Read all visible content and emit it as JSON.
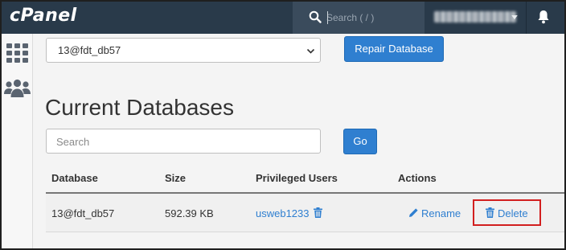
{
  "topbar": {
    "logo": "cPanel",
    "search_placeholder": "Search ( / )",
    "bell_icon": "bell-icon"
  },
  "sidebar": {
    "items": [
      {
        "icon": "grid-icon"
      },
      {
        "icon": "users-icon"
      }
    ]
  },
  "repair": {
    "selected_db": "13@fdt_db57",
    "button_label": "Repair Database"
  },
  "current": {
    "heading": "Current Databases",
    "search_placeholder": "Search",
    "go_label": "Go",
    "columns": [
      "Database",
      "Size",
      "Privileged Users",
      "Actions"
    ],
    "rows": [
      {
        "database": "13@fdt_db57",
        "size": "592.39 KB",
        "user": "usweb1233",
        "rename_label": "Rename",
        "delete_label": "Delete"
      }
    ]
  },
  "colors": {
    "topbar": "#293a4a",
    "accent": "#2f7fd0",
    "highlight": "#d21f1f"
  }
}
